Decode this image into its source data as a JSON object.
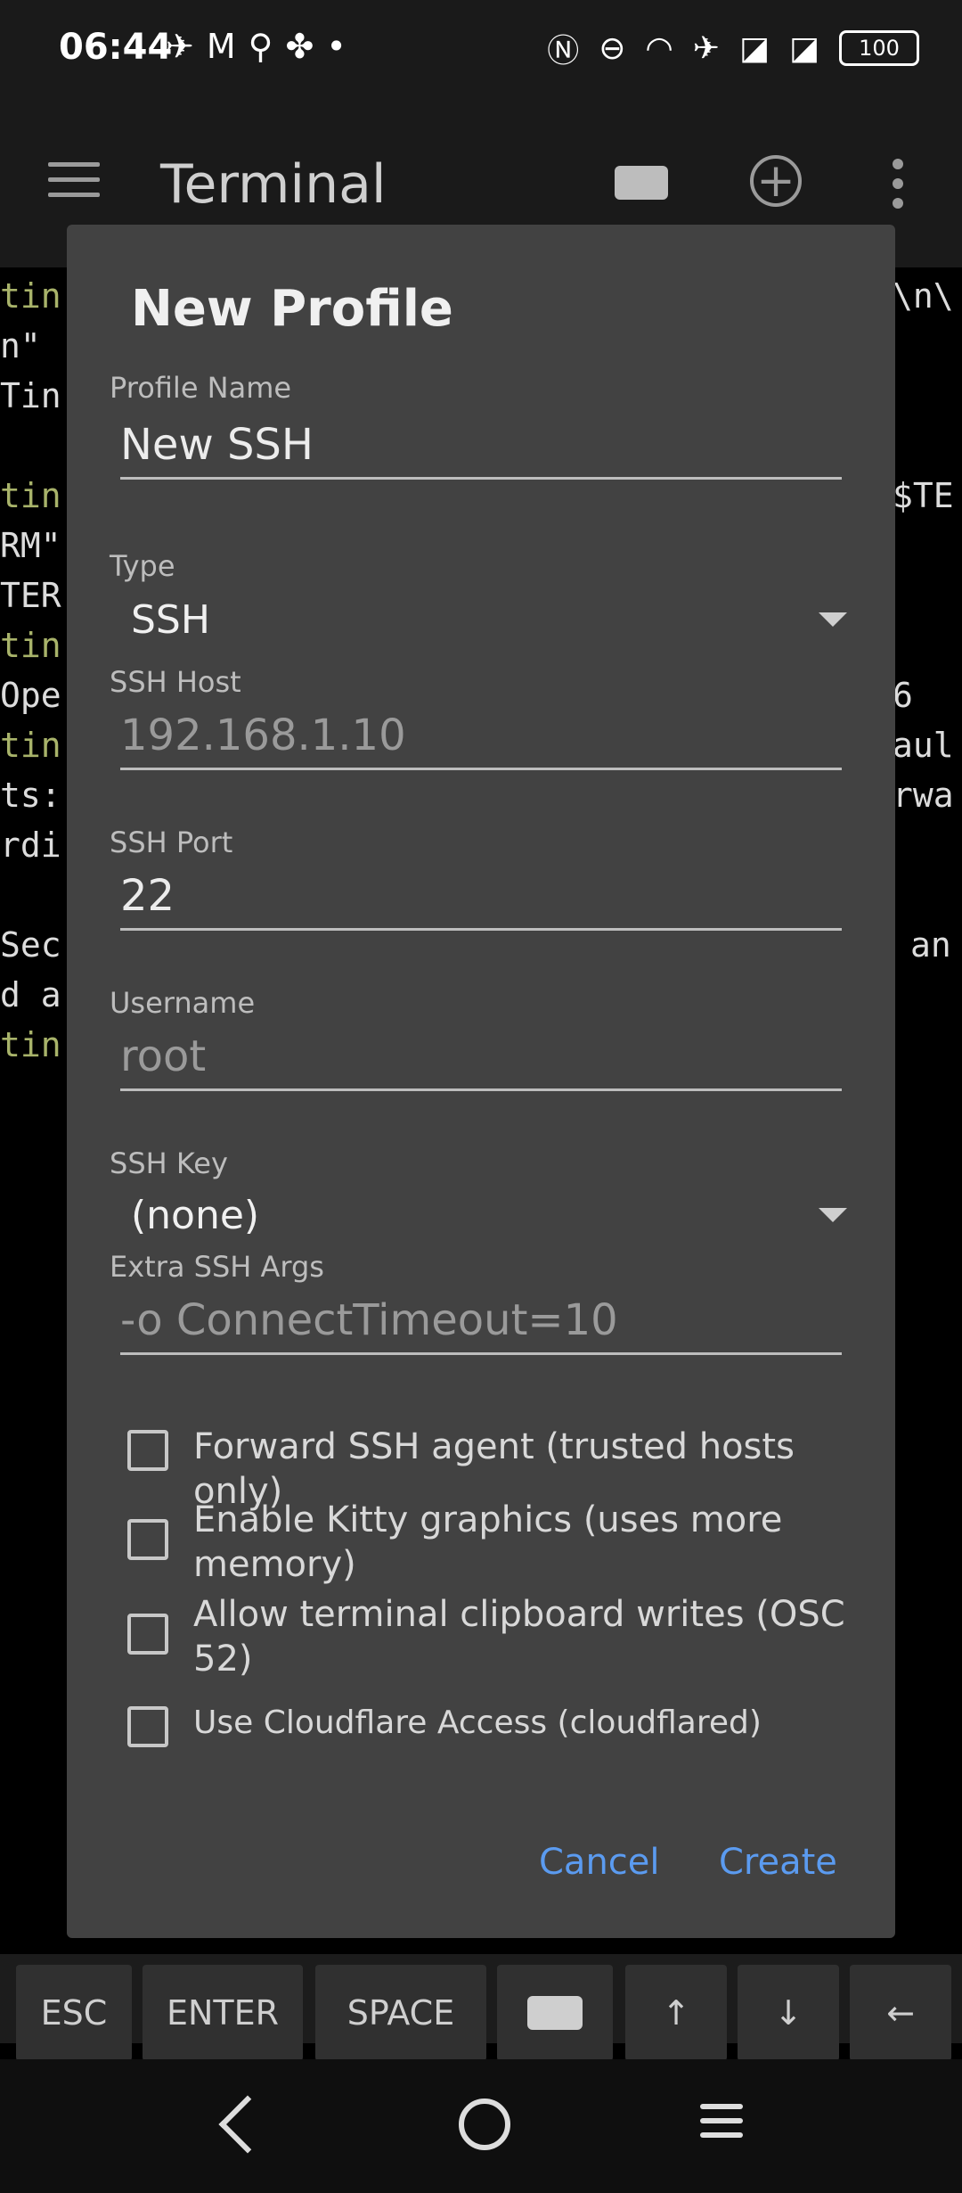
{
  "status_bar": {
    "time": "06:44",
    "left_icons": [
      "telegram-icon",
      "gmail-icon",
      "usb-icon",
      "fan-icon",
      "dot-icon"
    ],
    "right_icons": [
      "nfc-icon",
      "dnd-icon",
      "wifi-icon",
      "airplane-icon",
      "no-sim-icon",
      "no-sim-icon"
    ],
    "battery": "100"
  },
  "app_bar": {
    "title": "Terminal"
  },
  "terminal_lines": [
    {
      "text": "tin",
      "color": "green"
    },
    {
      "text": "n\"",
      "color": "normal"
    },
    {
      "text": "Tin",
      "color": "normal"
    },
    {
      "text": "tin",
      "color": "green"
    },
    {
      "text": "RM\"",
      "color": "normal"
    },
    {
      "text": "TER",
      "color": "normal"
    },
    {
      "text": "tin",
      "color": "green"
    },
    {
      "text": "Ope",
      "color": "normal"
    },
    {
      "text": "tin",
      "color": "green"
    },
    {
      "text": "ts:",
      "color": "normal"
    },
    {
      "text": "rdi",
      "color": "normal"
    },
    {
      "text": "Sec",
      "color": "normal"
    },
    {
      "text": "d a",
      "color": "normal"
    },
    {
      "text": "tin",
      "color": "green"
    }
  ],
  "terminal_right": [
    "\\n\\",
    "$TE",
    "6",
    "aul",
    "rwa",
    "an"
  ],
  "dialog": {
    "title": "New Profile",
    "profile_name_label": "Profile Name",
    "profile_name_value": "New SSH",
    "type_label": "Type",
    "type_value": "SSH",
    "ssh_host_label": "SSH Host",
    "ssh_host_placeholder": "192.168.1.10",
    "ssh_port_label": "SSH Port",
    "ssh_port_value": "22",
    "username_label": "Username",
    "username_placeholder": "root",
    "ssh_key_label": "SSH Key",
    "ssh_key_value": "(none)",
    "extra_args_label": "Extra SSH Args",
    "extra_args_placeholder": "-o ConnectTimeout=10",
    "checkboxes": [
      {
        "label": "Forward SSH agent (trusted hosts only)",
        "checked": false
      },
      {
        "label": "Enable Kitty graphics (uses more memory)",
        "checked": false
      },
      {
        "label": "Allow terminal clipboard writes (OSC 52)",
        "checked": false
      },
      {
        "label": "Use Cloudflare Access (cloudflared)",
        "checked": false
      }
    ],
    "cancel_label": "Cancel",
    "create_label": "Create"
  },
  "extra_keys": {
    "esc": "ESC",
    "enter": "ENTER",
    "space": "SPACE",
    "up": "↑",
    "down": "↓",
    "left": "←"
  },
  "colors": {
    "accent": "#5b9bf0",
    "dialog_bg": "#424242",
    "terminal_green": "#a8b36a"
  }
}
